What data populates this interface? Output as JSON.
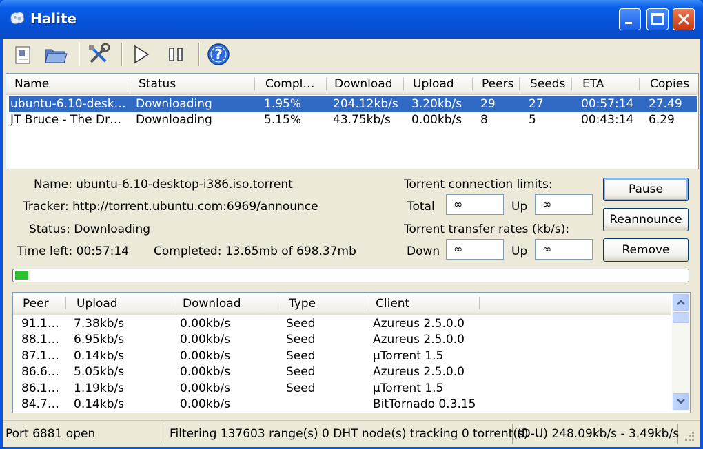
{
  "window": {
    "title": "Halite"
  },
  "colors": {
    "titlebar": "#0552d8",
    "selection": "#316ac5",
    "progress": "#2ec02e"
  },
  "toolbar": {
    "icons": [
      "add-torrent-icon",
      "open-folder-icon",
      "settings-tools-icon",
      "resume-play-icon",
      "pause-icon",
      "help-icon"
    ]
  },
  "torrents": {
    "columns": [
      "Name",
      "Status",
      "Compl…",
      "Download",
      "Upload",
      "Peers",
      "Seeds",
      "ETA",
      "Copies"
    ],
    "rows": [
      {
        "name": "ubuntu-6.10-desk…",
        "status": "Downloading",
        "compl": "1.95%",
        "download": "204.12kb/s",
        "upload": "3.20kb/s",
        "peers": "29",
        "seeds": "27",
        "eta": "00:57:14",
        "copies": "27.49"
      },
      {
        "name": "JT Bruce - The Dr…",
        "status": "Downloading",
        "compl": "5.15%",
        "download": "43.75kb/s",
        "upload": "0.00kb/s",
        "peers": "8",
        "seeds": "5",
        "eta": "00:43:14",
        "copies": "6.29"
      }
    ]
  },
  "details": {
    "name": "Name: ubuntu-6.10-desktop-i386.iso.torrent",
    "tracker": "Tracker: http://torrent.ubuntu.com:6969/announce",
    "status": "Status: Downloading",
    "time_left": "Time left: 00:57:14",
    "completed": "Completed: 13.65mb of 698.37mb",
    "conn_limits_label": "Torrent connection limits:",
    "total_label": "Total",
    "total_value": "∞",
    "up_label": "Up",
    "conn_up_value": "∞",
    "rates_label": "Torrent transfer rates (kb/s):",
    "down_label": "Down",
    "rate_down_value": "∞",
    "rate_up_value": "∞",
    "pause_button": "Pause",
    "reannounce_button": "Reannounce",
    "remove_button": "Remove",
    "progress_fraction": 0.0195
  },
  "peers": {
    "columns": [
      "Peer",
      "Upload",
      "Download",
      "Type",
      "Client"
    ],
    "rows": [
      {
        "peer": "91.1…",
        "upload": "7.38kb/s",
        "download": "0.00kb/s",
        "type": "Seed",
        "client": "Azureus 2.5.0.0"
      },
      {
        "peer": "88.1…",
        "upload": "6.95kb/s",
        "download": "0.00kb/s",
        "type": "Seed",
        "client": "Azureus 2.5.0.0"
      },
      {
        "peer": "87.1…",
        "upload": "0.14kb/s",
        "download": "0.00kb/s",
        "type": "Seed",
        "client": "µTorrent 1.5"
      },
      {
        "peer": "86.6…",
        "upload": "5.05kb/s",
        "download": "0.00kb/s",
        "type": "Seed",
        "client": "Azureus 2.5.0.0"
      },
      {
        "peer": "86.1…",
        "upload": "1.19kb/s",
        "download": "0.00kb/s",
        "type": "Seed",
        "client": "µTorrent 1.5"
      },
      {
        "peer": "84.7…",
        "upload": "0.14kb/s",
        "download": "0.00kb/s",
        "type": "",
        "client": "BitTornado 0.3.15"
      }
    ]
  },
  "statusbar": {
    "port": "Port 6881 open",
    "filtering": "Filtering 137603 range(s) 0 DHT node(s) tracking 0 torrent(s)",
    "rates": "(D-U) 248.09kb/s - 3.49kb/s"
  }
}
